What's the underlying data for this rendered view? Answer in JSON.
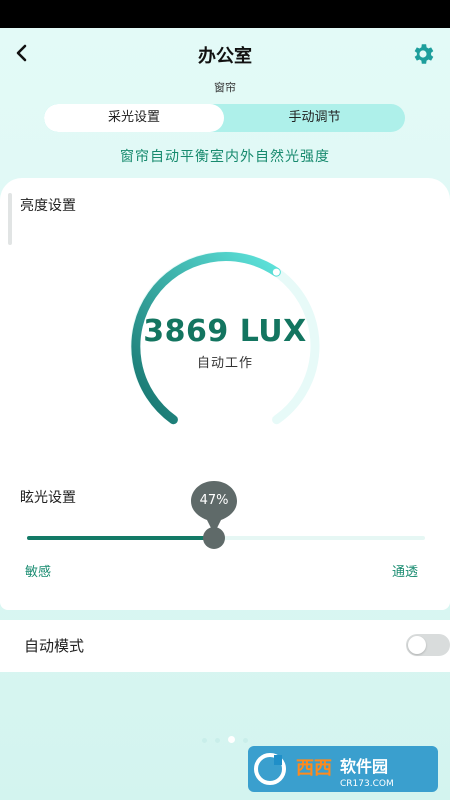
{
  "header": {
    "title": "办公室",
    "back_icon": "chevron-left-icon",
    "settings_icon": "gear-icon"
  },
  "subtitle": "窗帘",
  "tabs": [
    {
      "label": "采光设置",
      "selected": true
    },
    {
      "label": "手动调节",
      "selected": false
    }
  ],
  "description": "窗帘自动平衡室内外自然光强度",
  "brightness": {
    "label": "亮度设置",
    "value_text": "3869 LUX",
    "status": "自动工作",
    "gauge_fraction": 0.62
  },
  "glare": {
    "label": "眩光设置",
    "percent": 47,
    "percent_text": "47%",
    "left_label": "敏感",
    "right_label": "通透"
  },
  "auto_mode": {
    "label": "自动模式",
    "enabled": false
  },
  "pager": {
    "count": 4,
    "active": 2
  },
  "watermark": {
    "text": "西西软件园",
    "sub": "CR173.COM"
  },
  "colors": {
    "accent": "#137560",
    "gauge_start": "#14706a",
    "gauge_end": "#5fe5dd",
    "track": "#e7faf8"
  }
}
